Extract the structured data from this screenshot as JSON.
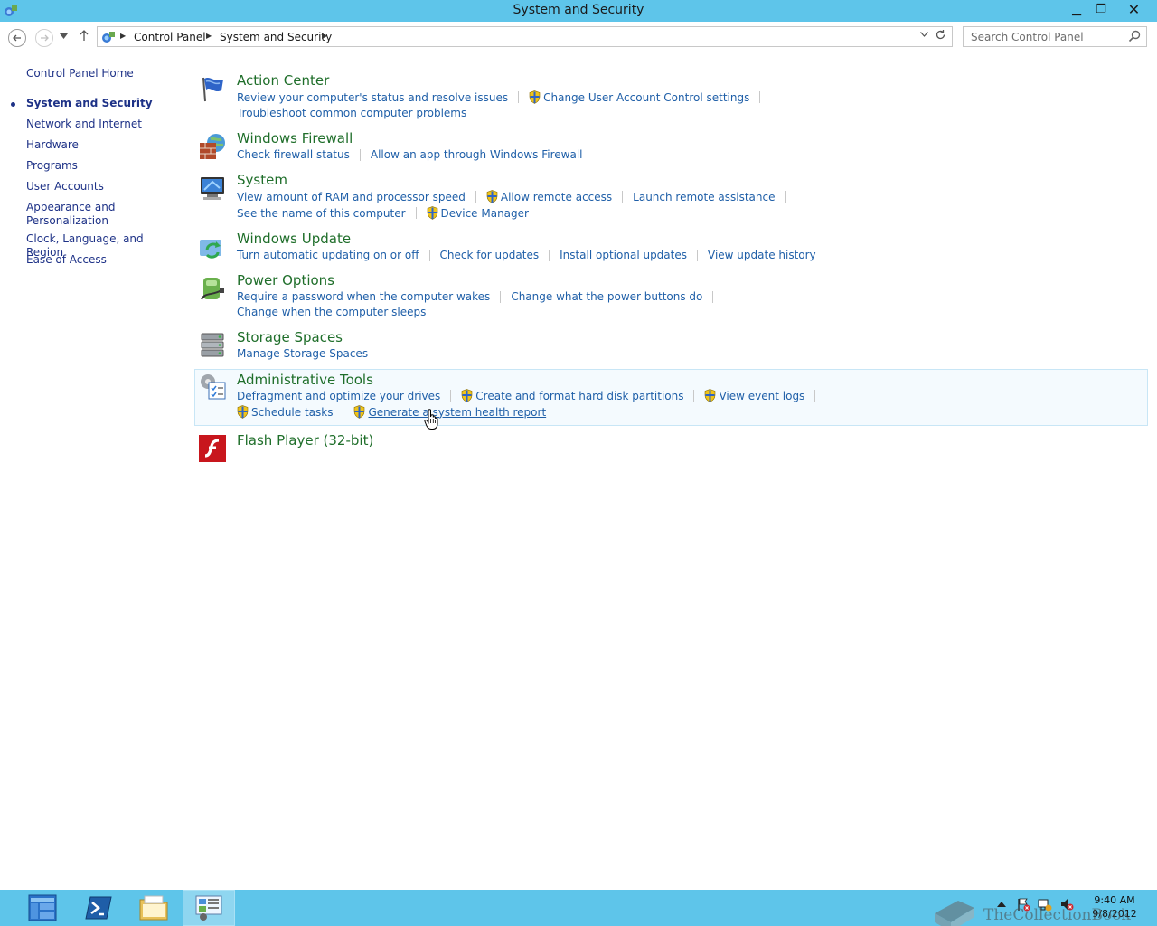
{
  "window": {
    "title": "System and Security",
    "minimize_glyph": "▁",
    "maximize_glyph": "❐",
    "close_glyph": "✕"
  },
  "nav": {
    "breadcrumb": [
      "Control Panel",
      "System and Security"
    ],
    "search_placeholder": "Search Control Panel"
  },
  "sidebar": {
    "items": [
      {
        "label": "Control Panel Home",
        "current": false
      },
      {
        "label": "System and Security",
        "current": true
      },
      {
        "label": "Network and Internet",
        "current": false
      },
      {
        "label": "Hardware",
        "current": false
      },
      {
        "label": "Programs",
        "current": false
      },
      {
        "label": "User Accounts",
        "current": false
      },
      {
        "label": "Appearance and Personalization",
        "current": false
      },
      {
        "label": "Clock, Language, and Region",
        "current": false
      },
      {
        "label": "Ease of Access",
        "current": false
      }
    ]
  },
  "categories": [
    {
      "title": "Action Center",
      "icon": "flag-icon",
      "rows": [
        [
          {
            "label": "Review your computer's status and resolve issues",
            "shield": false
          },
          {
            "label": "Change User Account Control settings",
            "shield": true
          }
        ],
        [
          {
            "label": "Troubleshoot common computer problems",
            "shield": false
          }
        ]
      ]
    },
    {
      "title": "Windows Firewall",
      "icon": "firewall-icon",
      "rows": [
        [
          {
            "label": "Check firewall status",
            "shield": false
          },
          {
            "label": "Allow an app through Windows Firewall",
            "shield": false
          }
        ]
      ]
    },
    {
      "title": "System",
      "icon": "computer-icon",
      "rows": [
        [
          {
            "label": "View amount of RAM and processor speed",
            "shield": false
          },
          {
            "label": "Allow remote access",
            "shield": true
          },
          {
            "label": "Launch remote assistance",
            "shield": false
          }
        ],
        [
          {
            "label": "See the name of this computer",
            "shield": false
          },
          {
            "label": "Device Manager",
            "shield": true
          }
        ]
      ]
    },
    {
      "title": "Windows Update",
      "icon": "windows-update-icon",
      "rows": [
        [
          {
            "label": "Turn automatic updating on or off",
            "shield": false
          },
          {
            "label": "Check for updates",
            "shield": false
          },
          {
            "label": "Install optional updates",
            "shield": false
          },
          {
            "label": "View update history",
            "shield": false
          }
        ]
      ]
    },
    {
      "title": "Power Options",
      "icon": "power-options-icon",
      "rows": [
        [
          {
            "label": "Require a password when the computer wakes",
            "shield": false
          },
          {
            "label": "Change what the power buttons do",
            "shield": false
          }
        ],
        [
          {
            "label": "Change when the computer sleeps",
            "shield": false
          }
        ]
      ]
    },
    {
      "title": "Storage Spaces",
      "icon": "storage-spaces-icon",
      "rows": [
        [
          {
            "label": "Manage Storage Spaces",
            "shield": false
          }
        ]
      ]
    },
    {
      "title": "Administrative Tools",
      "icon": "administrative-tools-icon",
      "hovered": true,
      "rows": [
        [
          {
            "label": "Defragment and optimize your drives",
            "shield": false
          },
          {
            "label": "Create and format hard disk partitions",
            "shield": true
          },
          {
            "label": "View event logs",
            "shield": true
          }
        ],
        [
          {
            "label": "Schedule tasks",
            "shield": true
          },
          {
            "label": "Generate a system health report",
            "shield": true,
            "hovered": true
          }
        ]
      ]
    },
    {
      "title": "Flash Player (32-bit)",
      "icon": "flash-player-icon",
      "rows": []
    }
  ],
  "taskbar": {
    "clock_time": "9:40 AM",
    "clock_date": "9/8/2012",
    "watermark": "TheCollectionBook"
  },
  "colors": {
    "titlebar": "#5ec5ea",
    "link": "#1f5fa8",
    "category_title": "#1f6e2a",
    "sidebar_link": "#1e3287"
  }
}
